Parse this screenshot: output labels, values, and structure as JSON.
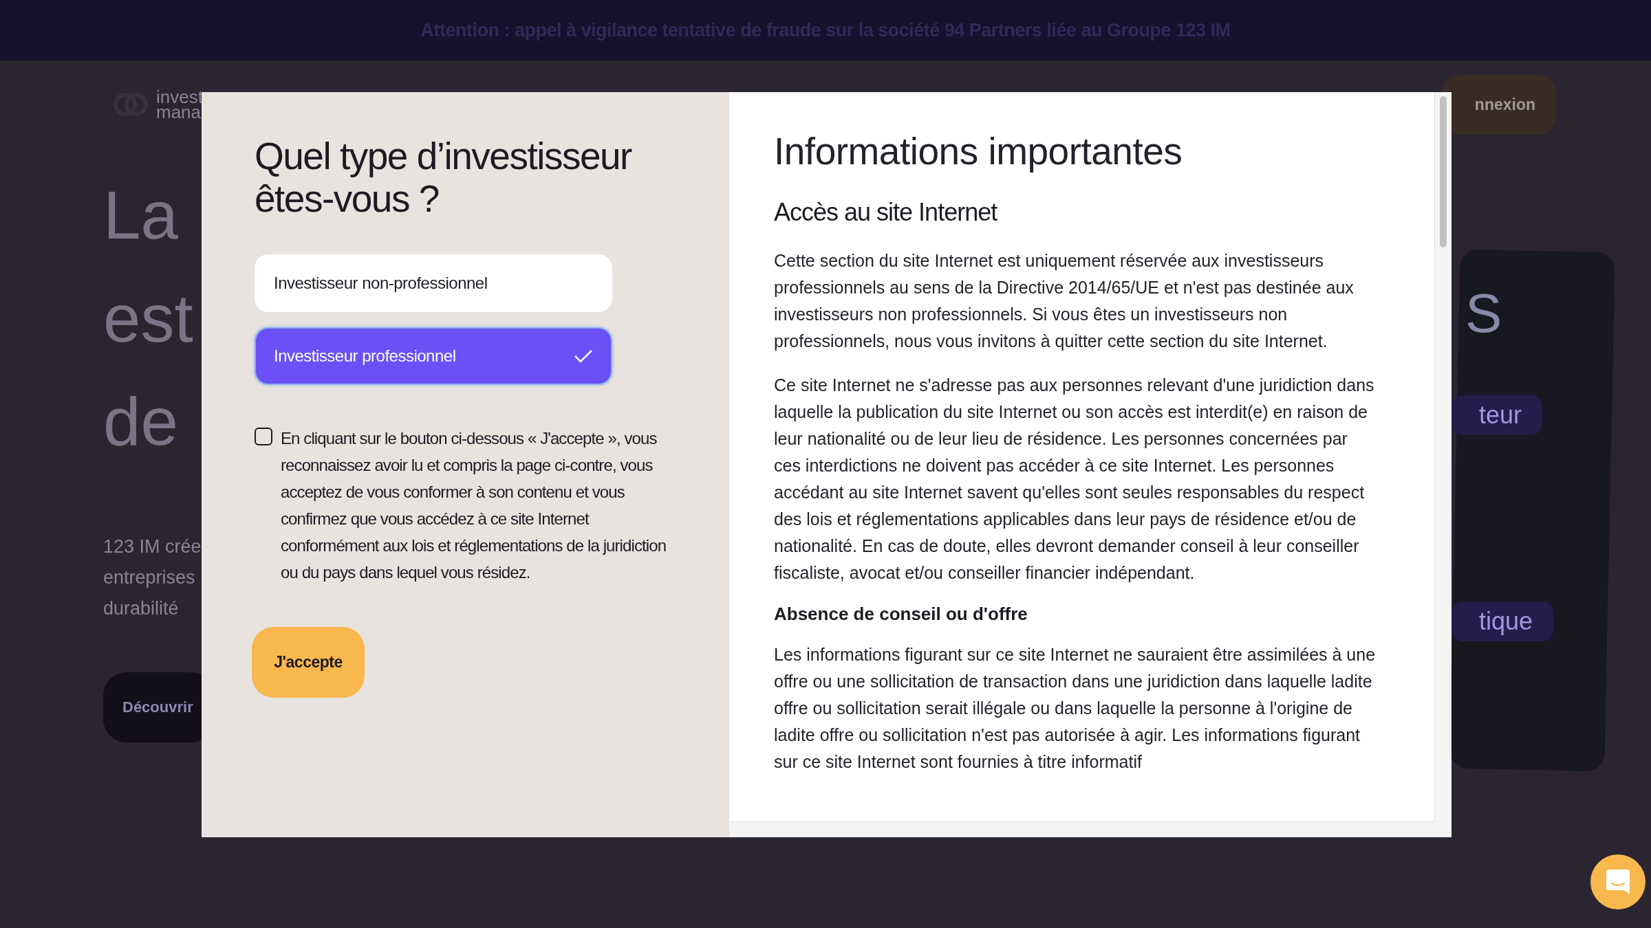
{
  "banner": {
    "text": "Attention : appel à vigilance tentative de fraude sur la société 94 Partners liée au Groupe 123 IM"
  },
  "background": {
    "logo_lines": [
      "invest",
      "mana"
    ],
    "login_button": "nnexion",
    "hero_lines": [
      "La",
      "est",
      "de"
    ],
    "intro_lines": [
      "123 IM crée",
      "entreprises",
      "durabilité"
    ],
    "cta": "Découvrir",
    "card": {
      "heading": "S",
      "tags": [
        "teur",
        "tique"
      ]
    }
  },
  "modal": {
    "title": "Quel type d’investisseur êtes-vous ?",
    "options": [
      {
        "label": "Investisseur non-professionnel",
        "selected": false
      },
      {
        "label": "Investisseur professionnel",
        "selected": true
      }
    ],
    "consent": {
      "checked": false,
      "text": "En cliquant sur le bouton ci-dessous « J'accepte », vous reconnaissez avoir lu et compris la page ci-contre, vous acceptez de vous conformer à son contenu et vous confirmez que vous accédez à ce site Internet conformément aux lois et réglementations de la juridiction ou du pays dans lequel vous résidez."
    },
    "accept_button": "J'accepte",
    "info": {
      "title": "Informations importantes",
      "sections": [
        {
          "kind": "large",
          "heading": "Accès au site Internet",
          "paragraphs": [
            "Cette section du site Internet est uniquement réservée aux investisseurs professionnels au sens de la Directive 2014/65/UE et n'est pas destinée aux investisseurs non professionnels. Si vous êtes un investisseurs non professionnels, nous vous invitons à quitter cette section du site Internet.",
            "Ce site Internet ne s'adresse pas aux personnes relevant d'une juridiction dans laquelle la publication du site Internet ou son accès est interdit(e) en raison de leur nationalité ou de leur lieu de résidence. Les personnes concernées par ces interdictions ne doivent pas accéder à ce site Internet. Les personnes accédant au site Internet savent qu'elles sont seules responsables du respect des lois et réglementations applicables dans leur pays de résidence et/ou de nationalité. En cas de doute, elles devront demander conseil à leur conseiller fiscaliste, avocat et/ou conseiller financier indépendant."
          ]
        },
        {
          "kind": "small",
          "heading": "Absence de conseil ou d'offre",
          "paragraphs": [
            "Les informations figurant sur ce site Internet ne sauraient être assimilées à une offre ou une sollicitation de transaction dans une juridiction dans laquelle ladite offre ou sollicitation serait illégale ou dans laquelle la personne à l'origine de ladite offre ou sollicitation n'est pas autorisée à agir. Les informations figurant sur ce site Internet sont fournies à titre informatif"
          ]
        }
      ]
    }
  }
}
